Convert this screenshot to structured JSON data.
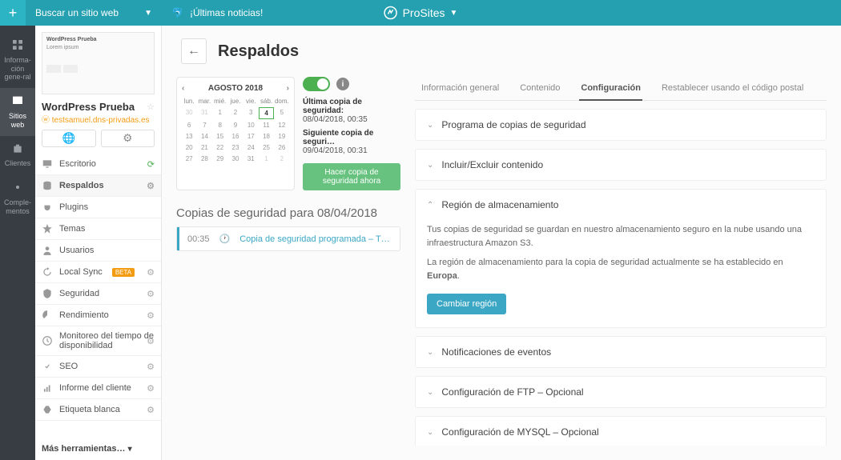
{
  "topbar": {
    "search_label": "Buscar un sitio web",
    "news_label": "¡Últimas noticias!",
    "logo_text": "ProSites"
  },
  "rail": {
    "items": [
      {
        "label": "Informa-ción gene-ral"
      },
      {
        "label": "Sitios web"
      },
      {
        "label": "Clientes"
      },
      {
        "label": "Comple-mentos"
      }
    ]
  },
  "site": {
    "title": "WordPress Prueba",
    "url": "testsamuel.dns-privadas.es"
  },
  "nav": {
    "items": [
      {
        "label": "Escritorio",
        "right": "refresh"
      },
      {
        "label": "Respaldos",
        "right": "gear",
        "active": true
      },
      {
        "label": "Plugins"
      },
      {
        "label": "Temas"
      },
      {
        "label": "Usuarios"
      },
      {
        "label": "Local Sync",
        "badge": "BETA",
        "right": "gear"
      },
      {
        "label": "Seguridad",
        "right": "gear"
      },
      {
        "label": "Rendimiento",
        "right": "gear"
      },
      {
        "label": "Monitoreo del tiempo de disponibilidad",
        "right": "gear"
      },
      {
        "label": "SEO",
        "right": "gear"
      },
      {
        "label": "Informe del cliente",
        "right": "gear"
      },
      {
        "label": "Etiqueta blanca",
        "right": "gear"
      }
    ],
    "more": "Más herramientas…"
  },
  "page": {
    "title": "Respaldos"
  },
  "calendar": {
    "month": "AGOSTO 2018",
    "dows": [
      "lun.",
      "mar.",
      "mié.",
      "jue.",
      "vie.",
      "sáb.",
      "dom."
    ],
    "selected_day": "4"
  },
  "backup": {
    "last_label": "Última copia de seguridad:",
    "last_value": "08/04/2018, 00:35",
    "next_label": "Siguiente copia de seguri…",
    "next_value": "09/04/2018, 00:31",
    "now_button": "Hacer copia de seguridad ahora",
    "list_title": "Copias de seguridad para 08/04/2018",
    "entries": [
      {
        "time": "00:35",
        "desc": "Copia de seguridad programada – T…"
      }
    ]
  },
  "tabs": [
    {
      "label": "Información general"
    },
    {
      "label": "Contenido"
    },
    {
      "label": "Configuración",
      "active": true
    },
    {
      "label": "Restablecer usando el código postal"
    }
  ],
  "panels": {
    "schedule": "Programa de copias de seguridad",
    "include": "Incluir/Excluir contenido",
    "storage": {
      "title": "Región de almacenamiento",
      "p1": "Tus copias de seguridad se guardan en nuestro almacenamiento seguro en la nube usando una infraestructura Amazon S3.",
      "p2a": "La región de almacenamiento para la copia de seguridad actualmente se ha establecido en ",
      "p2b": "Europa",
      "button": "Cambiar región"
    },
    "events": "Notificaciones de eventos",
    "ftp": "Configuración de FTP – Opcional",
    "mysql": "Configuración de MYSQL – Opcional"
  }
}
